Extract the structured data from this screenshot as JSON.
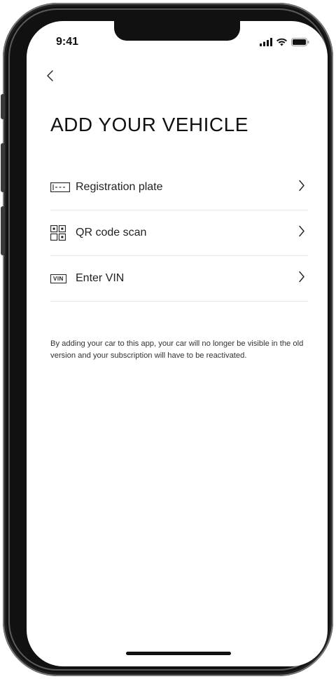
{
  "status_bar": {
    "time": "9:41"
  },
  "header": {
    "back_glyph": "<",
    "title": "ADD YOUR VEHICLE"
  },
  "options": [
    {
      "icon": "registration-plate-icon",
      "label": "Registration plate"
    },
    {
      "icon": "qr-code-icon",
      "label": "QR code scan"
    },
    {
      "icon": "vin-icon",
      "label": "Enter VIN",
      "icon_text": "VIN"
    }
  ],
  "disclaimer": "By adding your car to this app, your car will no longer be visible in the old version and your subscription will have to be reactivated."
}
